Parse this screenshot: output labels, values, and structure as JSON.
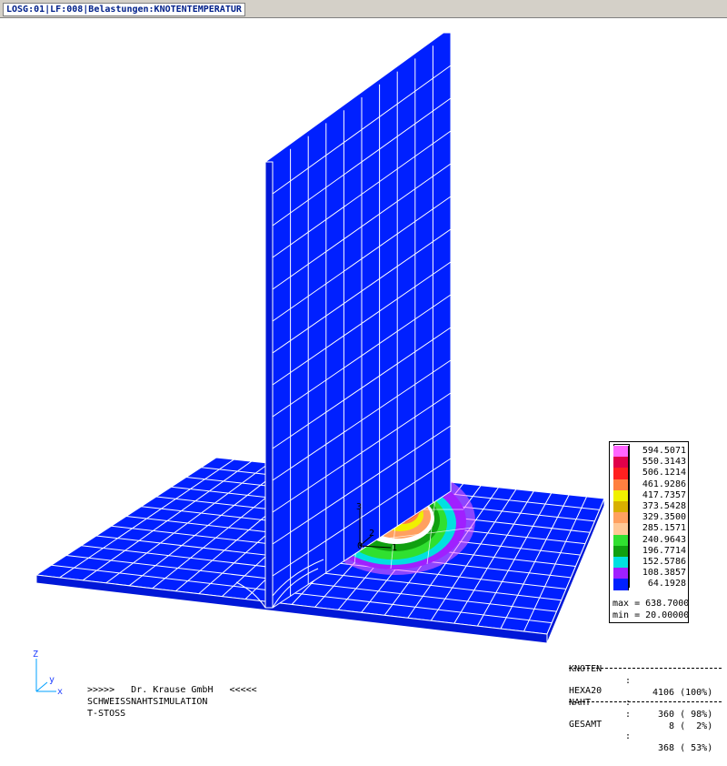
{
  "titlebar": {
    "text": "LOSG:01|LF:008|Belastungen:KNOTENTEMPERATUR"
  },
  "legend": {
    "levels": [
      {
        "value": "594.5071",
        "color": "#ff66ff"
      },
      {
        "value": "550.3143",
        "color": "#e0004a"
      },
      {
        "value": "506.1214",
        "color": "#ff2020"
      },
      {
        "value": "461.9286",
        "color": "#ff8040"
      },
      {
        "value": "417.7357",
        "color": "#f0f000"
      },
      {
        "value": "373.5428",
        "color": "#d8b000"
      },
      {
        "value": "329.3500",
        "color": "#ffa060"
      },
      {
        "value": "285.1571",
        "color": "#ffc896"
      },
      {
        "value": "240.9643",
        "color": "#30e030"
      },
      {
        "value": "196.7714",
        "color": "#10a010"
      },
      {
        "value": "152.5786",
        "color": "#00e0e0"
      },
      {
        "value": "108.3857",
        "color": "#a020ff"
      },
      {
        "value": "64.1928",
        "color": "#0020ff"
      }
    ],
    "max_label": "max = 638.7000",
    "min_label": "min = 20.00000"
  },
  "stats": {
    "knoten_label": "KNOTEN",
    "knoten_value": "4106 (100%)",
    "hexa_label": "HEXA20",
    "hexa_value": " 360 ( 98%)",
    "naht_label": "NAHT",
    "naht_value": "   8 (  2%)",
    "gesamt_label": "GESAMT",
    "gesamt_value": " 368 ( 53%)"
  },
  "footer": {
    "line1": ">>>>>   Dr. Krause GmbH   <<<<<",
    "line2": "SCHWEISSNAHTSIMULATION",
    "line3": "T-STOSS"
  },
  "axes": {
    "z": "Z",
    "y": "y",
    "x": "x",
    "local_1": "1",
    "local_2": "2",
    "local_3": "3",
    "local_0": "0"
  },
  "colors": {
    "mesh_blue": "#0020ff",
    "mesh_line": "#ffffff",
    "titlebar_text": "#00208a"
  }
}
